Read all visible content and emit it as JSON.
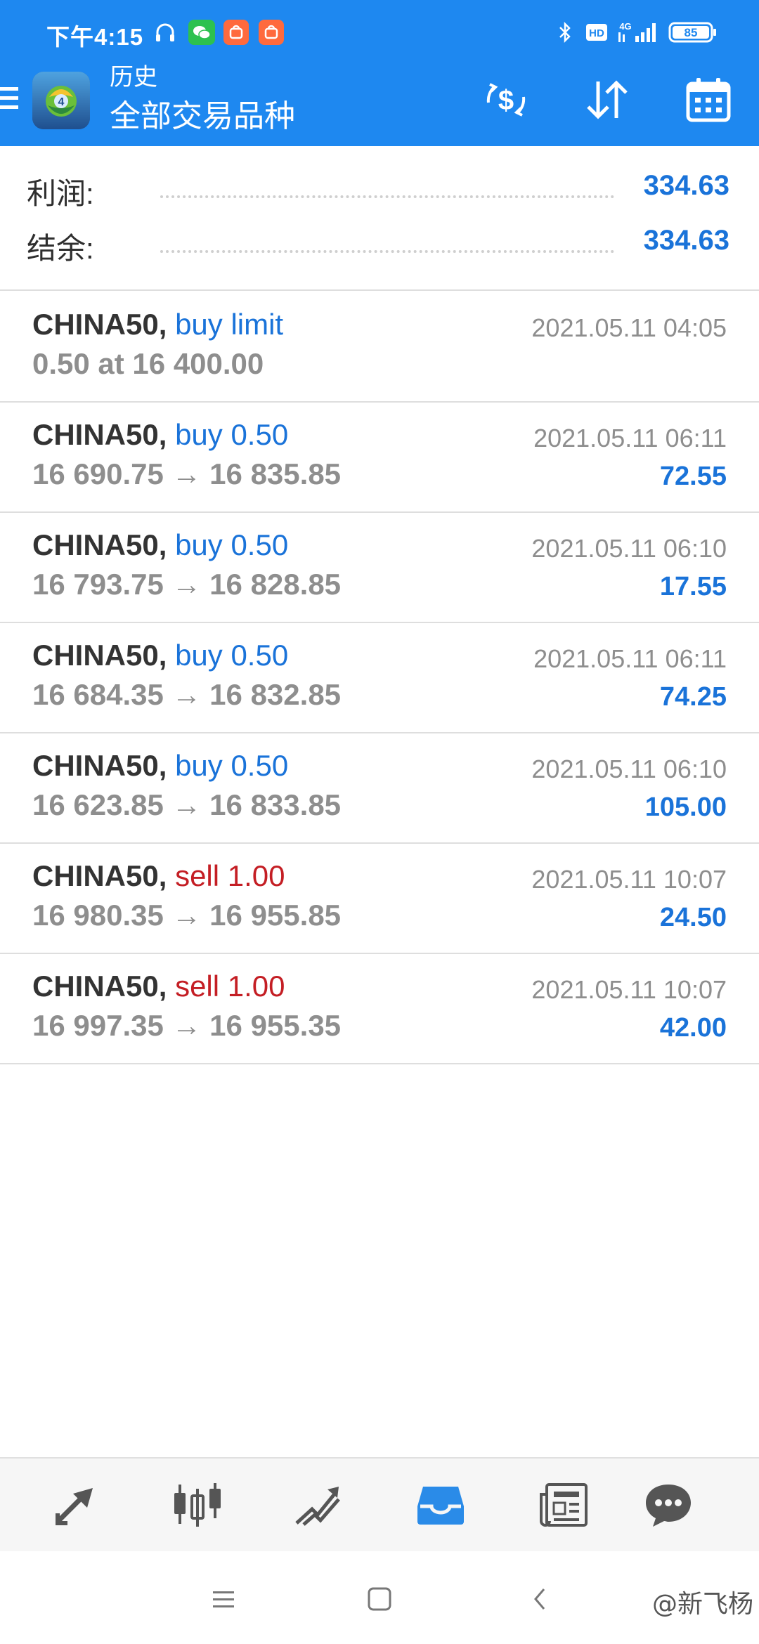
{
  "status_bar": {
    "time": "下午4:15",
    "network": "4G",
    "battery": "85",
    "icons": [
      "headset-icon",
      "wechat-icon",
      "mi-store-icon",
      "mi-app-icon",
      "bluetooth-icon",
      "hd-icon",
      "signal-icon",
      "battery-icon"
    ]
  },
  "app_bar": {
    "title": "历史",
    "subtitle": "全部交易品种",
    "actions": [
      "currency-exchange-icon",
      "sort-icon",
      "calendar-icon"
    ]
  },
  "summary": {
    "profit_label": "利润:",
    "profit_value": "334.63",
    "balance_label": "结余:",
    "balance_value": "334.63"
  },
  "deals": [
    {
      "symbol": "CHINA50,",
      "type": "buy limit",
      "side": "buy",
      "prices": "0.50 at 16 400.00",
      "time": "2021.05.11 04:05",
      "profit": ""
    },
    {
      "symbol": "CHINA50,",
      "type": "buy 0.50",
      "side": "buy",
      "prices": "16 690.75 → 16 835.85",
      "time": "2021.05.11 06:11",
      "profit": "72.55"
    },
    {
      "symbol": "CHINA50,",
      "type": "buy 0.50",
      "side": "buy",
      "prices": "16 793.75 → 16 828.85",
      "time": "2021.05.11 06:10",
      "profit": "17.55"
    },
    {
      "symbol": "CHINA50,",
      "type": "buy 0.50",
      "side": "buy",
      "prices": "16 684.35 → 16 832.85",
      "time": "2021.05.11 06:11",
      "profit": "74.25"
    },
    {
      "symbol": "CHINA50,",
      "type": "buy 0.50",
      "side": "buy",
      "prices": "16 623.85 → 16 833.85",
      "time": "2021.05.11 06:10",
      "profit": "105.00"
    },
    {
      "symbol": "CHINA50,",
      "type": "sell 1.00",
      "side": "sell",
      "prices": "16 980.35 → 16 955.85",
      "time": "2021.05.11 10:07",
      "profit": "24.50"
    },
    {
      "symbol": "CHINA50,",
      "type": "sell 1.00",
      "side": "sell",
      "prices": "16 997.35 → 16 955.35",
      "time": "2021.05.11 10:07",
      "profit": "42.00"
    }
  ],
  "tab_bar": {
    "tabs": [
      "quotes-icon",
      "chart-icon",
      "trade-icon",
      "history-icon",
      "news-icon",
      "chat-icon"
    ],
    "active": "history-icon"
  },
  "system_nav": {
    "buttons": [
      "menu-icon",
      "home-icon",
      "back-icon"
    ],
    "watermark": "@新飞杨"
  },
  "colors": {
    "app_bar": "#1e88f0",
    "buy": "#1a73d9",
    "sell": "#c41e24",
    "profit": "#1a73d9",
    "tab_active": "#2a8be8"
  }
}
